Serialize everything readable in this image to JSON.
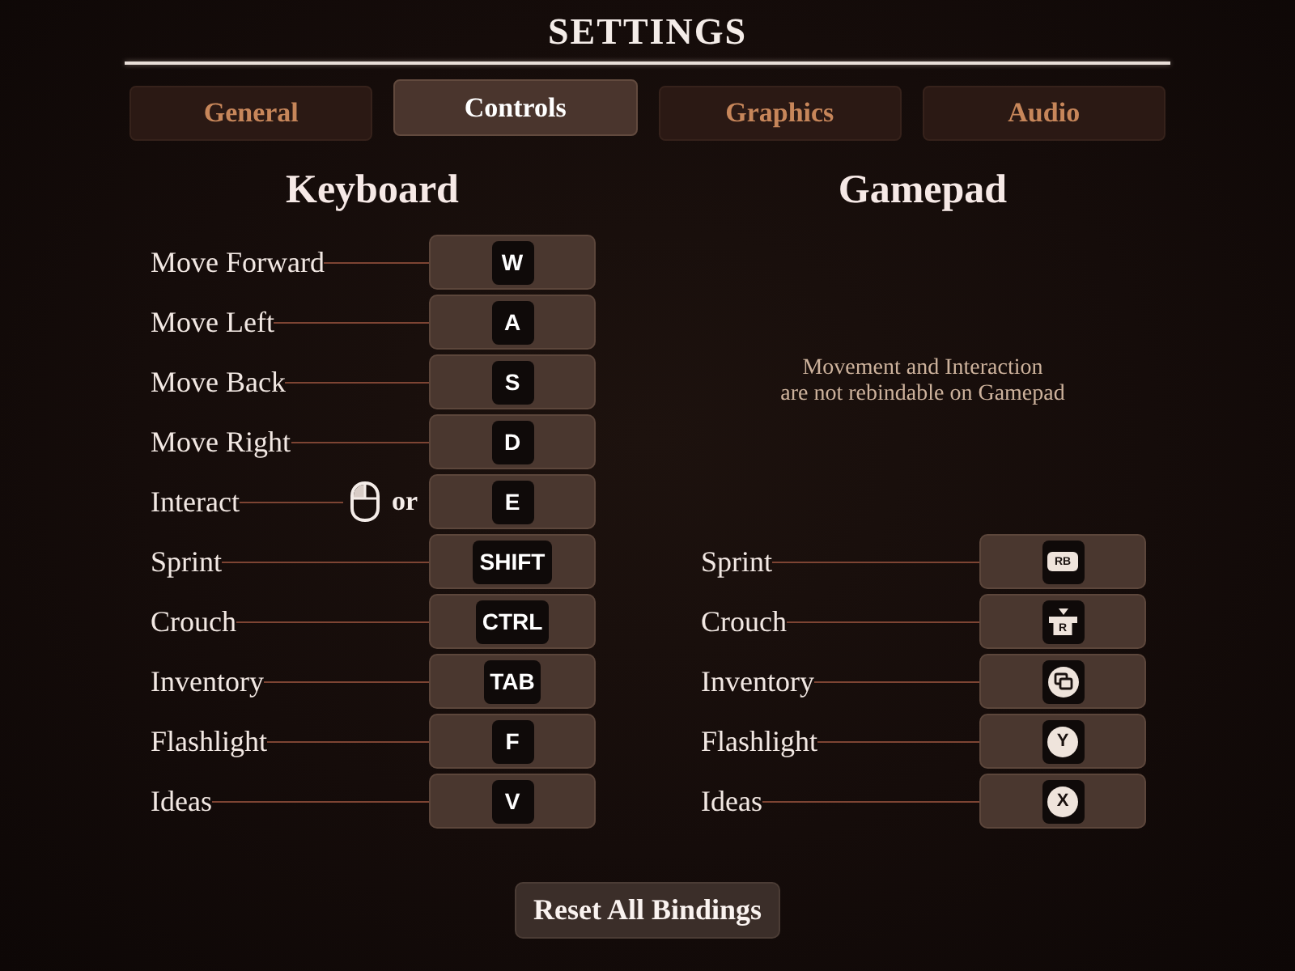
{
  "title": "SETTINGS",
  "tabs": [
    {
      "label": "General",
      "selected": false
    },
    {
      "label": "Controls",
      "selected": true
    },
    {
      "label": "Graphics",
      "selected": false
    },
    {
      "label": "Audio",
      "selected": false
    }
  ],
  "keyboard": {
    "heading": "Keyboard",
    "bindings": [
      {
        "action": "Move Forward",
        "key": "W"
      },
      {
        "action": "Move Left",
        "key": "A"
      },
      {
        "action": "Move Back",
        "key": "S"
      },
      {
        "action": "Move Right",
        "key": "D"
      },
      {
        "action": "Interact",
        "alternate": {
          "kind": "mouse",
          "joiner": "or"
        },
        "key": "E"
      },
      {
        "action": "Sprint",
        "key": "SHIFT"
      },
      {
        "action": "Crouch",
        "key": "CTRL"
      },
      {
        "action": "Inventory",
        "key": "TAB"
      },
      {
        "action": "Flashlight",
        "key": "F"
      },
      {
        "action": "Ideas",
        "key": "V"
      }
    ]
  },
  "gamepad": {
    "heading": "Gamepad",
    "note_lines": [
      "Movement and Interaction",
      "are not rebindable on Gamepad"
    ],
    "bindings": [
      {
        "action": "Sprint",
        "button": {
          "kind": "bumper",
          "label": "RB"
        }
      },
      {
        "action": "Crouch",
        "button": {
          "kind": "stick",
          "label": "R"
        }
      },
      {
        "action": "Inventory",
        "button": {
          "kind": "view"
        }
      },
      {
        "action": "Flashlight",
        "button": {
          "kind": "face",
          "label": "Y"
        }
      },
      {
        "action": "Ideas",
        "button": {
          "kind": "face",
          "label": "X"
        }
      }
    ]
  },
  "reset_button": "Reset All Bindings"
}
